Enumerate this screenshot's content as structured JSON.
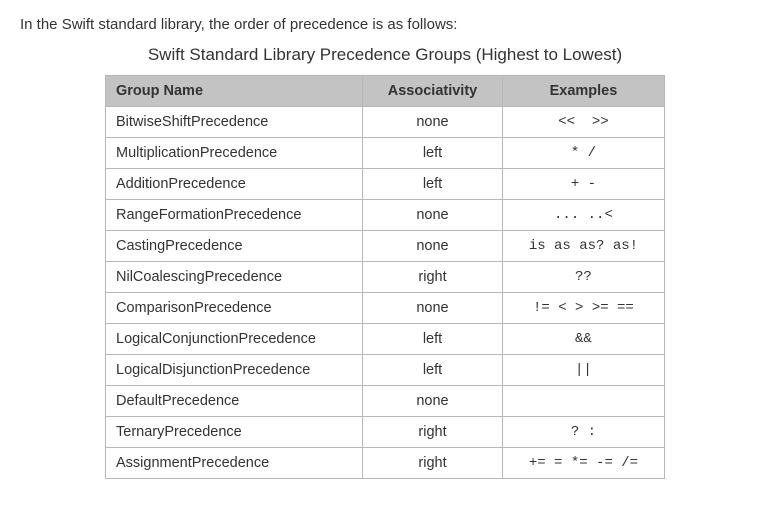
{
  "intro": "In the Swift standard library, the order of precedence is as follows:",
  "caption": "Swift Standard Library Precedence Groups (Highest to Lowest)",
  "columns": {
    "group": "Group Name",
    "assoc": "Associativity",
    "examp": "Examples"
  },
  "chart_data": {
    "type": "table",
    "title": "Swift Standard Library Precedence Groups (Highest to Lowest)",
    "columns": [
      "Group Name",
      "Associativity",
      "Examples"
    ],
    "rows": [
      {
        "group": "BitwiseShiftPrecedence",
        "assoc": "none",
        "examp": "<<  >>"
      },
      {
        "group": "MultiplicationPrecedence",
        "assoc": "left",
        "examp": "* /"
      },
      {
        "group": "AdditionPrecedence",
        "assoc": "left",
        "examp": "+ -"
      },
      {
        "group": "RangeFormationPrecedence",
        "assoc": "none",
        "examp": "... ..<"
      },
      {
        "group": "CastingPrecedence",
        "assoc": "none",
        "examp": "is as as? as!"
      },
      {
        "group": "NilCoalescingPrecedence",
        "assoc": "right",
        "examp": "??"
      },
      {
        "group": "ComparisonPrecedence",
        "assoc": "none",
        "examp": "!= < > >= =="
      },
      {
        "group": "LogicalConjunctionPrecedence",
        "assoc": "left",
        "examp": "&&"
      },
      {
        "group": "LogicalDisjunctionPrecedence",
        "assoc": "left",
        "examp": "||"
      },
      {
        "group": "DefaultPrecedence",
        "assoc": "none",
        "examp": ""
      },
      {
        "group": "TernaryPrecedence",
        "assoc": "right",
        "examp": "? :"
      },
      {
        "group": "AssignmentPrecedence",
        "assoc": "right",
        "examp": "+= = *= -= /="
      }
    ]
  }
}
